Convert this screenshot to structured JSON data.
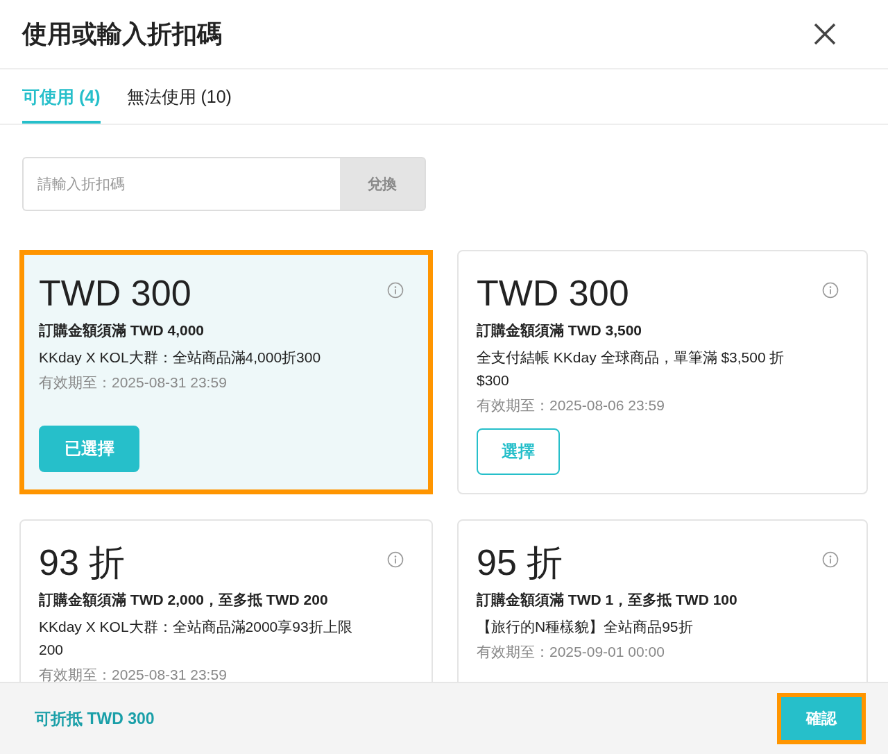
{
  "dialog": {
    "title": "使用或輸入折扣碼"
  },
  "tabs": [
    {
      "label": "可使用 (4)",
      "selected": true
    },
    {
      "label": "無法使用 (10)",
      "selected": false
    }
  ],
  "code_input": {
    "placeholder": "請輸入折扣碼",
    "button": "兌換",
    "disabled": true
  },
  "coupons": [
    {
      "amount": "TWD 300",
      "condition": "訂購金額須滿 TWD 4,000",
      "description": "KKday X KOL大群：全站商品滿4,000折300",
      "validity": "有效期至：2025-08-31 23:59",
      "button": "已選擇",
      "selected": true
    },
    {
      "amount": "TWD 300",
      "condition": "訂購金額須滿 TWD 3,500",
      "description": "全支付結帳 KKday 全球商品，單筆滿 $3,500 折 $300",
      "validity": "有效期至：2025-08-06 23:59",
      "button": "選擇",
      "selected": false
    },
    {
      "amount": "93 折",
      "condition": "訂購金額須滿 TWD 2,000，至多抵 TWD 200",
      "description": "KKday X KOL大群：全站商品滿2000享93折上限 200",
      "validity": "有效期至：2025-08-31 23:59",
      "selected": false
    },
    {
      "amount": "95 折",
      "condition": "訂購金額須滿 TWD 1，至多抵 TWD 100",
      "description": "【旅行的N種樣貌】全站商品95折",
      "validity": "有效期至：2025-09-01 00:00",
      "selected": false
    }
  ],
  "footer": {
    "discount": "可折抵 TWD 300",
    "confirm": "確認"
  }
}
